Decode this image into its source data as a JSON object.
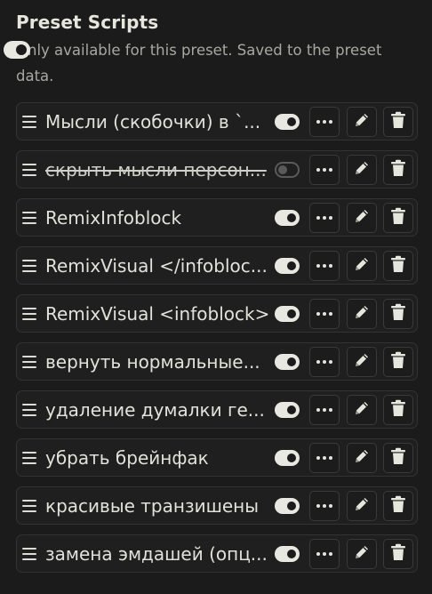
{
  "header": {
    "title": "Preset Scripts",
    "description": "Only available for this preset. Saved to the preset data.",
    "master_enabled": true
  },
  "scripts": [
    {
      "name": "Мысли (скобочки) в `...",
      "enabled": true
    },
    {
      "name": "скрыть мысли персон...",
      "enabled": false
    },
    {
      "name": "RemixInfoblock",
      "enabled": true
    },
    {
      "name": "RemixVisual </infobloc...",
      "enabled": true
    },
    {
      "name": "RemixVisual <infoblock>",
      "enabled": true
    },
    {
      "name": "вернуть нормальные...",
      "enabled": true
    },
    {
      "name": "удаление думалки ге...",
      "enabled": true
    },
    {
      "name": "убрать брейнфак",
      "enabled": true
    },
    {
      "name": "красивые транзишены",
      "enabled": true
    },
    {
      "name": "замена эмдашей (опц...",
      "enabled": true
    }
  ],
  "icons": {
    "drag": "drag-handle-icon",
    "more": "ellipsis-icon",
    "edit": "pencil-icon",
    "delete": "trash-icon"
  },
  "colors": {
    "background": "#1b1b1b",
    "text": "#dcdcd2",
    "muted": "#a8a8a0",
    "border": "#333333"
  }
}
